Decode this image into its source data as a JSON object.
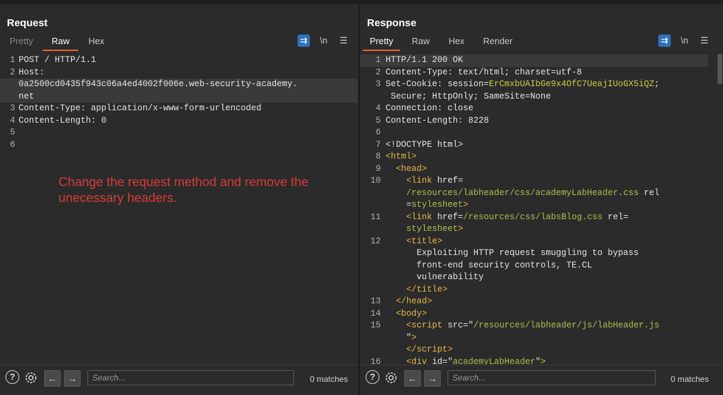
{
  "request": {
    "title": "Request",
    "tabs": [
      "Pretty",
      "Raw",
      "Hex"
    ],
    "active_tab": "Raw",
    "icons": [
      "wrap-icon",
      "newline-icon",
      "menu-icon"
    ],
    "newline_label": "\\n",
    "lines": [
      {
        "n": "1",
        "text": "POST / HTTP/1.1"
      },
      {
        "n": "2",
        "text": "Host:"
      },
      {
        "n": "",
        "text": "0a2500cd0435f943c06a4ed4002f006e.web-security-academy."
      },
      {
        "n": "",
        "text": "net"
      },
      {
        "n": "3",
        "key": "Content-Type:",
        "val": " application/x-www-form-urlencoded"
      },
      {
        "n": "4",
        "key": "Content-Length:",
        "val": " 0"
      },
      {
        "n": "5",
        "text": ""
      },
      {
        "n": "6",
        "text": ""
      }
    ],
    "annotation": "Change the request method and remove the unecessary headers.",
    "search_placeholder": "Search...",
    "matches": "0 matches"
  },
  "response": {
    "title": "Response",
    "tabs": [
      "Pretty",
      "Raw",
      "Hex",
      "Render"
    ],
    "active_tab": "Pretty",
    "newline_label": "\\n",
    "lines": [
      {
        "n": "1",
        "html": "HTTP/1.1 200 OK"
      },
      {
        "n": "2",
        "html": "Content-Type: text/html; charset=utf-8"
      },
      {
        "n": "3",
        "html": "Set-Cookie: session=<span class='sess'>ErCmxbUAIbGe9x4OfC7UeajIUoGX5iQZ</span>;"
      },
      {
        "n": "",
        "html": " Secure; HttpOnly; SameSite=None"
      },
      {
        "n": "4",
        "html": "Connection: close"
      },
      {
        "n": "5",
        "html": "Content-Length: 8228"
      },
      {
        "n": "6",
        "html": ""
      },
      {
        "n": "7",
        "html": "&lt;!DOCTYPE html&gt;"
      },
      {
        "n": "8",
        "html": "<span class='tag'>&lt;html&gt;</span>"
      },
      {
        "n": "9",
        "html": "  <span class='tag'>&lt;head&gt;</span>"
      },
      {
        "n": "10",
        "html": "    <span class='tag'>&lt;link</span> href="
      },
      {
        "n": "",
        "html": "    <span class='str'>/resources/labheader/css/academyLabHeader.css</span> rel"
      },
      {
        "n": "",
        "html": "    =<span class='str'>stylesheet</span><span class='tag'>&gt;</span>"
      },
      {
        "n": "11",
        "html": "    <span class='tag'>&lt;link</span> href=<span class='str'>/resources/css/labsBlog.css</span> rel="
      },
      {
        "n": "",
        "html": "    <span class='str'>stylesheet</span><span class='tag'>&gt;</span>"
      },
      {
        "n": "12",
        "html": "    <span class='tag'>&lt;title&gt;</span>"
      },
      {
        "n": "",
        "html": "      Exploiting HTTP request smuggling to bypass"
      },
      {
        "n": "",
        "html": "      front-end security controls, TE.CL"
      },
      {
        "n": "",
        "html": "      vulnerability"
      },
      {
        "n": "",
        "html": "    <span class='tag'>&lt;/title&gt;</span>"
      },
      {
        "n": "13",
        "html": "  <span class='tag'>&lt;/head&gt;</span>"
      },
      {
        "n": "14",
        "html": "  <span class='tag'>&lt;body&gt;</span>"
      },
      {
        "n": "15",
        "html": "    <span class='tag'>&lt;script</span> src=\"<span class='str'>/resources/labheader/js/labHeader.js</span>"
      },
      {
        "n": "",
        "html": "    \"<span class='tag'>&gt;</span>"
      },
      {
        "n": "",
        "html": "    <span class='tag'>&lt;/script&gt;</span>"
      },
      {
        "n": "16",
        "html": "    <span class='tag'>&lt;div</span> id=\"<span class='str'>academyLabHeader</span>\"<span class='tag'>&gt;</span>"
      }
    ],
    "search_placeholder": "Search...",
    "matches": "0 matches"
  },
  "colors": {
    "accent": "#e8662d",
    "button_blue": "#2d72b8",
    "annotation_red": "#d83a3a"
  }
}
